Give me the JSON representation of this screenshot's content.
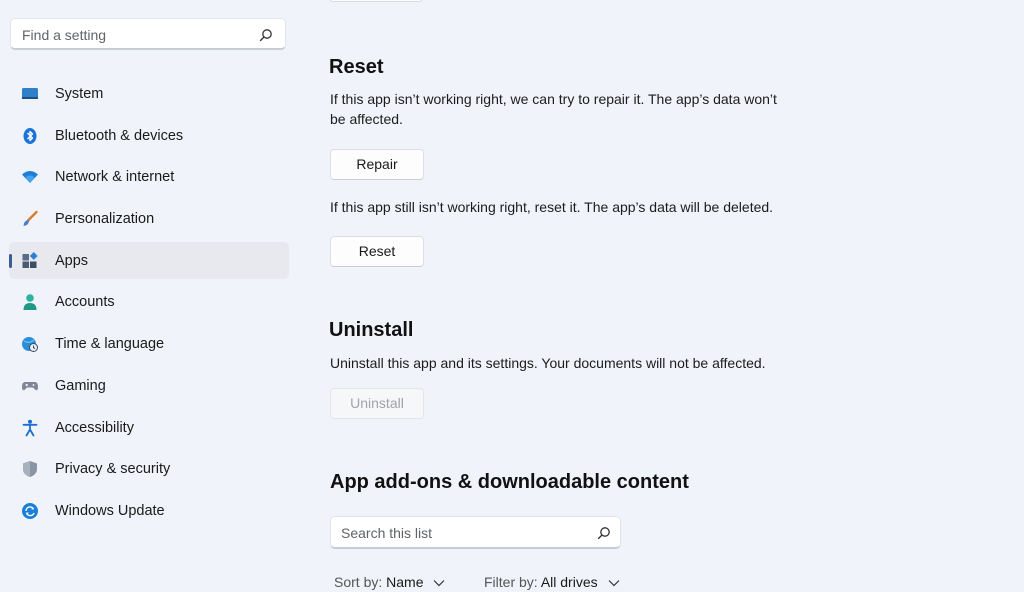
{
  "sidebar": {
    "search_placeholder": "Find a setting",
    "items": [
      {
        "label": "System",
        "icon": "system-icon"
      },
      {
        "label": "Bluetooth & devices",
        "icon": "bluetooth-icon"
      },
      {
        "label": "Network & internet",
        "icon": "wifi-icon"
      },
      {
        "label": "Personalization",
        "icon": "brush-icon"
      },
      {
        "label": "Apps",
        "icon": "apps-icon",
        "active": true
      },
      {
        "label": "Accounts",
        "icon": "person-icon"
      },
      {
        "label": "Time & language",
        "icon": "globe-clock-icon"
      },
      {
        "label": "Gaming",
        "icon": "gamepad-icon"
      },
      {
        "label": "Accessibility",
        "icon": "accessibility-icon"
      },
      {
        "label": "Privacy & security",
        "icon": "shield-icon"
      },
      {
        "label": "Windows Update",
        "icon": "update-icon"
      }
    ]
  },
  "reset_section": {
    "title": "Reset",
    "repair_desc": "If this app isn’t working right, we can try to repair it. The app’s data won’t be affected.",
    "repair_label": "Repair",
    "reset_desc": "If this app still isn’t working right, reset it. The app’s data will be deleted.",
    "reset_label": "Reset"
  },
  "uninstall_section": {
    "title": "Uninstall",
    "desc": "Uninstall this app and its settings. Your documents will not be affected.",
    "button_label": "Uninstall"
  },
  "addons_section": {
    "title": "App add-ons & downloadable content",
    "search_placeholder": "Search this list",
    "sort_label": "Sort by:",
    "sort_value": "Name",
    "filter_label": "Filter by:",
    "filter_value": "All drives"
  },
  "colors": {
    "accent": "#3b5d94",
    "background": "#f0f3f9"
  }
}
